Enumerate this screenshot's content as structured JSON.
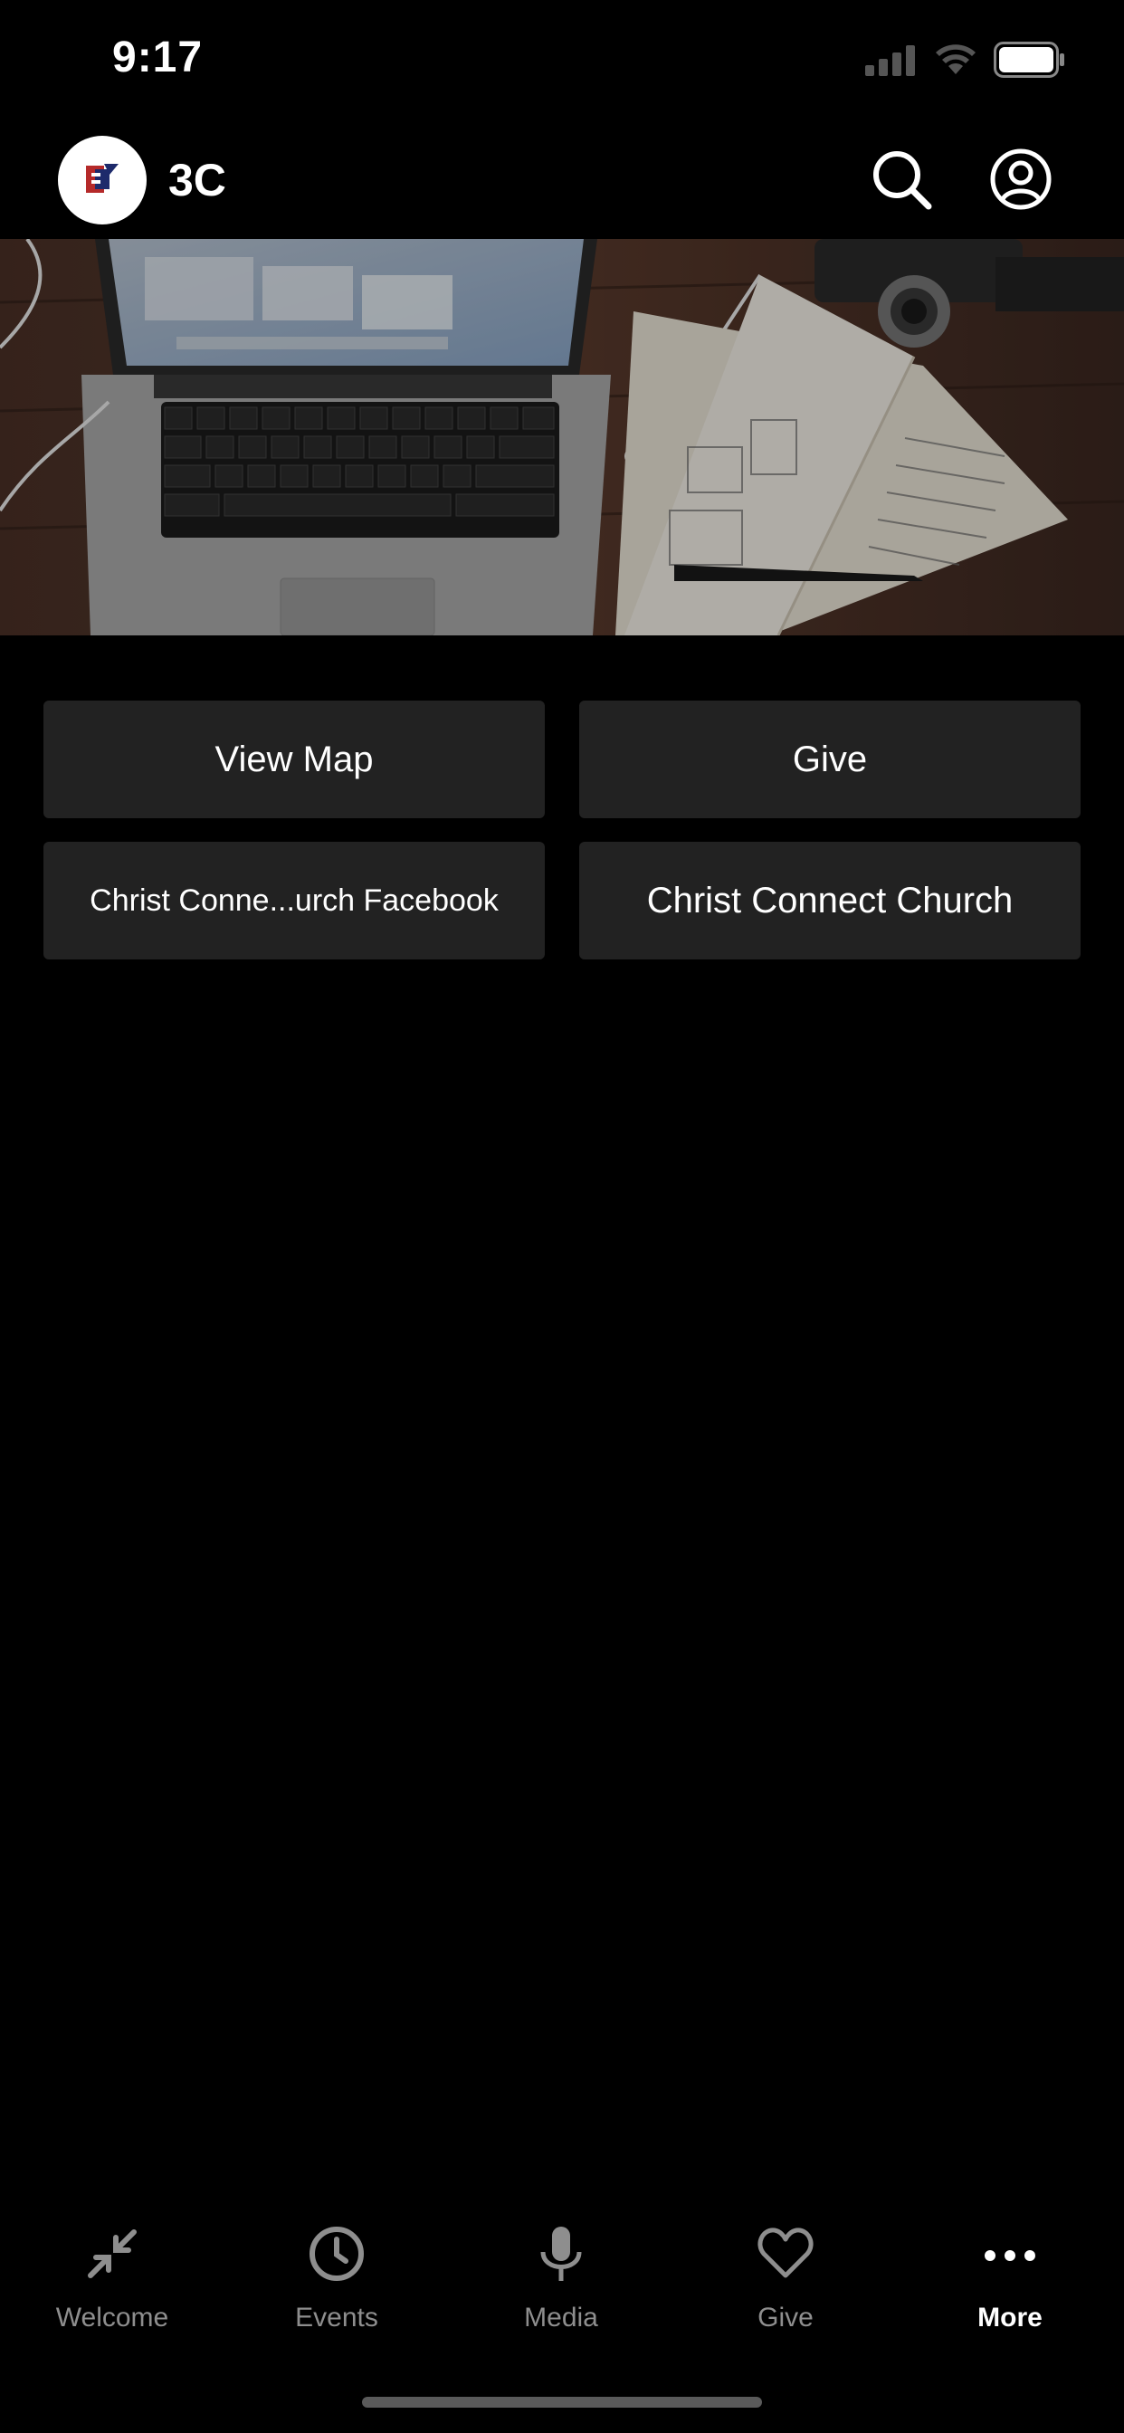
{
  "status_bar": {
    "time": "9:17"
  },
  "header": {
    "title": "3C"
  },
  "buttons": [
    {
      "label": "View Map"
    },
    {
      "label": "Give"
    },
    {
      "label": "Christ Conne...urch Facebook"
    },
    {
      "label": "Christ Connect Church"
    }
  ],
  "tabs": [
    {
      "label": "Welcome",
      "icon": "collapse-arrows-icon"
    },
    {
      "label": "Events",
      "icon": "clock-icon"
    },
    {
      "label": "Media",
      "icon": "microphone-icon"
    },
    {
      "label": "Give",
      "icon": "heart-icon"
    },
    {
      "label": "More",
      "icon": "more-dots-icon",
      "active": true
    }
  ],
  "colors": {
    "background": "#000000",
    "button_bg": "#222222",
    "tab_inactive": "#8e8e8e",
    "tab_active": "#ffffff"
  }
}
